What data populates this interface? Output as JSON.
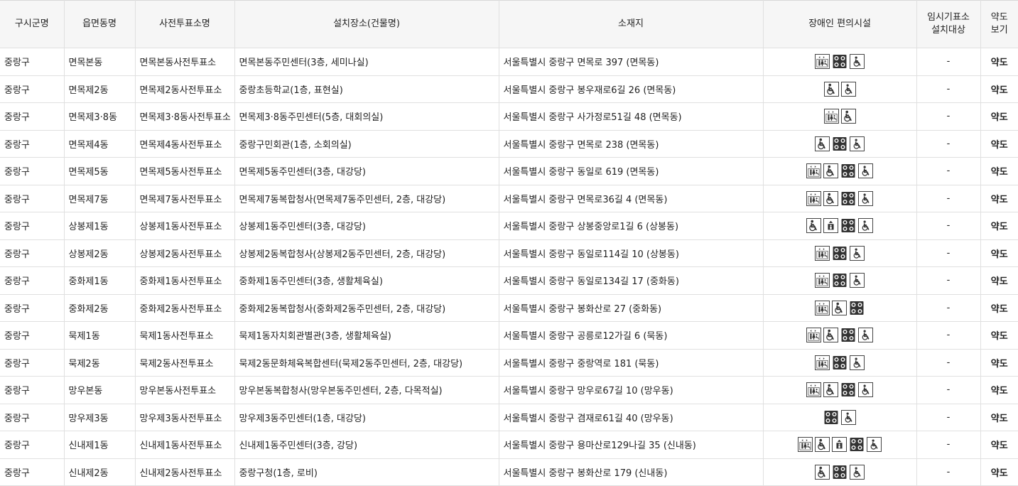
{
  "headers": [
    "구시군명",
    "읍면동명",
    "사전투표소명",
    "설치장소(건물명)",
    "소재지",
    "장애인 편의시설",
    "임시기표소\n설치대상",
    "약도\n보기"
  ],
  "rows": [
    {
      "sigungu": "중랑구",
      "dong": "면목본동",
      "station": "면목본동사전투표소",
      "place": "면목본동주민센터(3층, 세미나실)",
      "address": "서울특별시 중랑구 면목로 397 (면목동)",
      "icons": [
        "toilet-icon",
        "braille-block-icon",
        "wheelchair-icon"
      ],
      "temp": "-",
      "map": "약도"
    },
    {
      "sigungu": "중랑구",
      "dong": "면목제2동",
      "station": "면목제2동사전투표소",
      "place": "중랑초등학교(1층, 표현실)",
      "address": "서울특별시 중랑구 봉우재로6길 26 (면목동)",
      "icons": [
        "ramp-icon",
        "wheelchair-icon"
      ],
      "temp": "-",
      "map": "약도"
    },
    {
      "sigungu": "중랑구",
      "dong": "면목제3·8동",
      "station": "면목제3·8동사전투표소",
      "place": "면목제3·8동주민센터(5층, 대회의실)",
      "address": "서울특별시 중랑구 사가정로51길 48 (면목동)",
      "icons": [
        "toilet-icon",
        "ramp-icon"
      ],
      "temp": "-",
      "map": "약도"
    },
    {
      "sigungu": "중랑구",
      "dong": "면목제4동",
      "station": "면목제4동사전투표소",
      "place": "중랑구민회관(1층, 소회의실)",
      "address": "서울특별시 중랑구 면목로 238 (면목동)",
      "icons": [
        "ramp-icon",
        "braille-block-icon",
        "wheelchair-icon"
      ],
      "temp": "-",
      "map": "약도"
    },
    {
      "sigungu": "중랑구",
      "dong": "면목제5동",
      "station": "면목제5동사전투표소",
      "place": "면목제5동주민센터(3층, 대강당)",
      "address": "서울특별시 중랑구 동일로 619 (면목동)",
      "icons": [
        "toilet-icon",
        "ramp-icon",
        "braille-block-icon",
        "wheelchair-icon"
      ],
      "temp": "-",
      "map": "약도"
    },
    {
      "sigungu": "중랑구",
      "dong": "면목제7동",
      "station": "면목제7동사전투표소",
      "place": "면목제7동복합청사(면목제7동주민센터, 2층, 대강당)",
      "address": "서울특별시 중랑구 면목로36길 4 (면목동)",
      "icons": [
        "toilet-icon",
        "ramp-icon",
        "braille-block-icon",
        "wheelchair-icon"
      ],
      "temp": "-",
      "map": "약도"
    },
    {
      "sigungu": "중랑구",
      "dong": "상봉제1동",
      "station": "상봉제1동사전투표소",
      "place": "상봉제1동주민센터(3층, 대강당)",
      "address": "서울특별시 중랑구 상봉중앙로1길 6 (상봉동)",
      "icons": [
        "ramp-icon",
        "elevator-icon",
        "braille-block-icon",
        "wheelchair-icon"
      ],
      "temp": "-",
      "map": "약도"
    },
    {
      "sigungu": "중랑구",
      "dong": "상봉제2동",
      "station": "상봉제2동사전투표소",
      "place": "상봉제2동복합청사(상봉제2동주민센터, 2층, 대강당)",
      "address": "서울특별시 중랑구 동일로114길 10 (상봉동)",
      "icons": [
        "toilet-icon",
        "braille-block-icon",
        "wheelchair-icon"
      ],
      "temp": "-",
      "map": "약도"
    },
    {
      "sigungu": "중랑구",
      "dong": "중화제1동",
      "station": "중화제1동사전투표소",
      "place": "중화제1동주민센터(3층, 생활체육실)",
      "address": "서울특별시 중랑구 동일로134길 17 (중화동)",
      "icons": [
        "toilet-icon",
        "braille-block-icon",
        "wheelchair-icon"
      ],
      "temp": "-",
      "map": "약도"
    },
    {
      "sigungu": "중랑구",
      "dong": "중화제2동",
      "station": "중화제2동사전투표소",
      "place": "중화제2동복합청사(중화제2동주민센터, 2층, 대강당)",
      "address": "서울특별시 중랑구 봉화산로 27 (중화동)",
      "icons": [
        "toilet-icon",
        "ramp-icon",
        "braille-block-icon"
      ],
      "temp": "-",
      "map": "약도"
    },
    {
      "sigungu": "중랑구",
      "dong": "묵제1동",
      "station": "묵제1동사전투표소",
      "place": "묵제1동자치회관별관(3층, 생활체육실)",
      "address": "서울특별시 중랑구 공릉로12가길 6 (묵동)",
      "icons": [
        "toilet-icon",
        "ramp-icon",
        "braille-block-icon",
        "wheelchair-icon"
      ],
      "temp": "-",
      "map": "약도"
    },
    {
      "sigungu": "중랑구",
      "dong": "묵제2동",
      "station": "묵제2동사전투표소",
      "place": "묵제2동문화체육복합센터(묵제2동주민센터, 2층, 대강당)",
      "address": "서울특별시 중랑구 중랑역로 181 (묵동)",
      "icons": [
        "toilet-icon",
        "braille-block-icon",
        "wheelchair-icon"
      ],
      "temp": "-",
      "map": "약도"
    },
    {
      "sigungu": "중랑구",
      "dong": "망우본동",
      "station": "망우본동사전투표소",
      "place": "망우본동복합청사(망우본동주민센터, 2층, 다목적실)",
      "address": "서울특별시 중랑구 망우로67길 10 (망우동)",
      "icons": [
        "toilet-icon",
        "ramp-icon",
        "braille-block-icon",
        "wheelchair-icon"
      ],
      "temp": "-",
      "map": "약도"
    },
    {
      "sigungu": "중랑구",
      "dong": "망우제3동",
      "station": "망우제3동사전투표소",
      "place": "망우제3동주민센터(1층, 대강당)",
      "address": "서울특별시 중랑구 겸재로61길 40 (망우동)",
      "icons": [
        "braille-block-icon",
        "wheelchair-icon"
      ],
      "temp": "-",
      "map": "약도"
    },
    {
      "sigungu": "중랑구",
      "dong": "신내제1동",
      "station": "신내제1동사전투표소",
      "place": "신내제1동주민센터(3층, 강당)",
      "address": "서울특별시 중랑구 용마산로129나길 35 (신내동)",
      "icons": [
        "toilet-icon",
        "ramp-icon",
        "elevator-icon",
        "braille-block-icon",
        "wheelchair-icon"
      ],
      "temp": "-",
      "map": "약도"
    },
    {
      "sigungu": "중랑구",
      "dong": "신내제2동",
      "station": "신내제2동사전투표소",
      "place": "중랑구청(1층, 로비)",
      "address": "서울특별시 중랑구 봉화산로 179 (신내동)",
      "icons": [
        "ramp-icon",
        "braille-block-icon",
        "wheelchair-icon"
      ],
      "temp": "-",
      "map": "약도"
    }
  ]
}
